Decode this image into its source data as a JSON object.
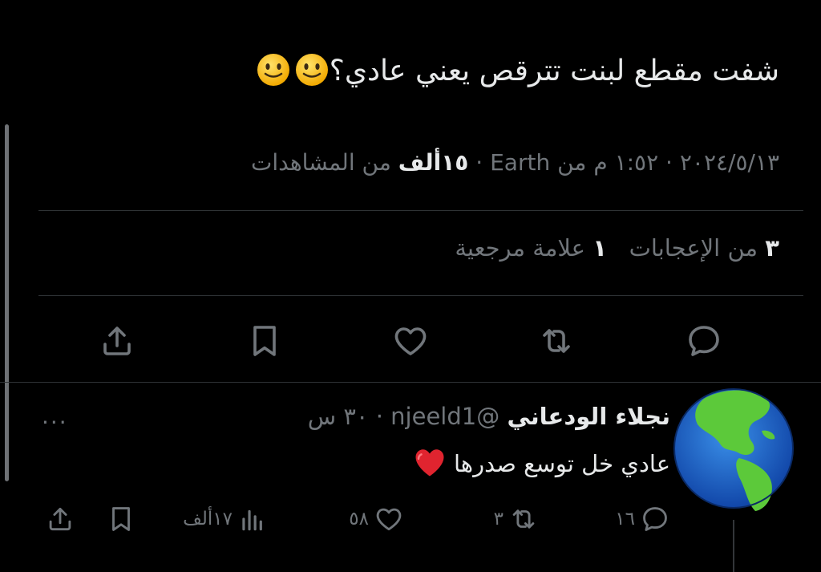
{
  "tweet": {
    "text": "شفت مقطع لبنت تترقص يعني عادي؟",
    "emojis": [
      "slightly-smiling-face",
      "slightly-smiling-face"
    ],
    "date": "٢٠٢٤/٥/١٣",
    "time": "١:٥٢ م",
    "source": "من Earth",
    "separator": "·",
    "views_count": "١٥ألف",
    "views_label": "من المشاهدات"
  },
  "stats": {
    "likes_count": "٣",
    "likes_label": "من الإعجابات",
    "bookmarks_count": "١",
    "bookmarks_label": "علامة مرجعية"
  },
  "actions": {
    "icons": [
      "reply-icon",
      "retweet-icon",
      "like-icon",
      "bookmark-icon",
      "share-icon"
    ]
  },
  "reply": {
    "name": "نجلاء الودعاني",
    "handle": "@njeeld1",
    "separator": "·",
    "time": "٣٠ س",
    "text": "عادي خل توسع صدرها",
    "text_emoji": "red-heart",
    "more": "···",
    "replies_count": "١٦",
    "retweets_count": "٣",
    "likes_count": "٥٨",
    "views_count": "١٧ألف"
  },
  "colors": {
    "background": "#000000",
    "text": "#e7e9ea",
    "secondary": "#71767b",
    "divider": "#2f3336",
    "heart": "#e0242f"
  }
}
